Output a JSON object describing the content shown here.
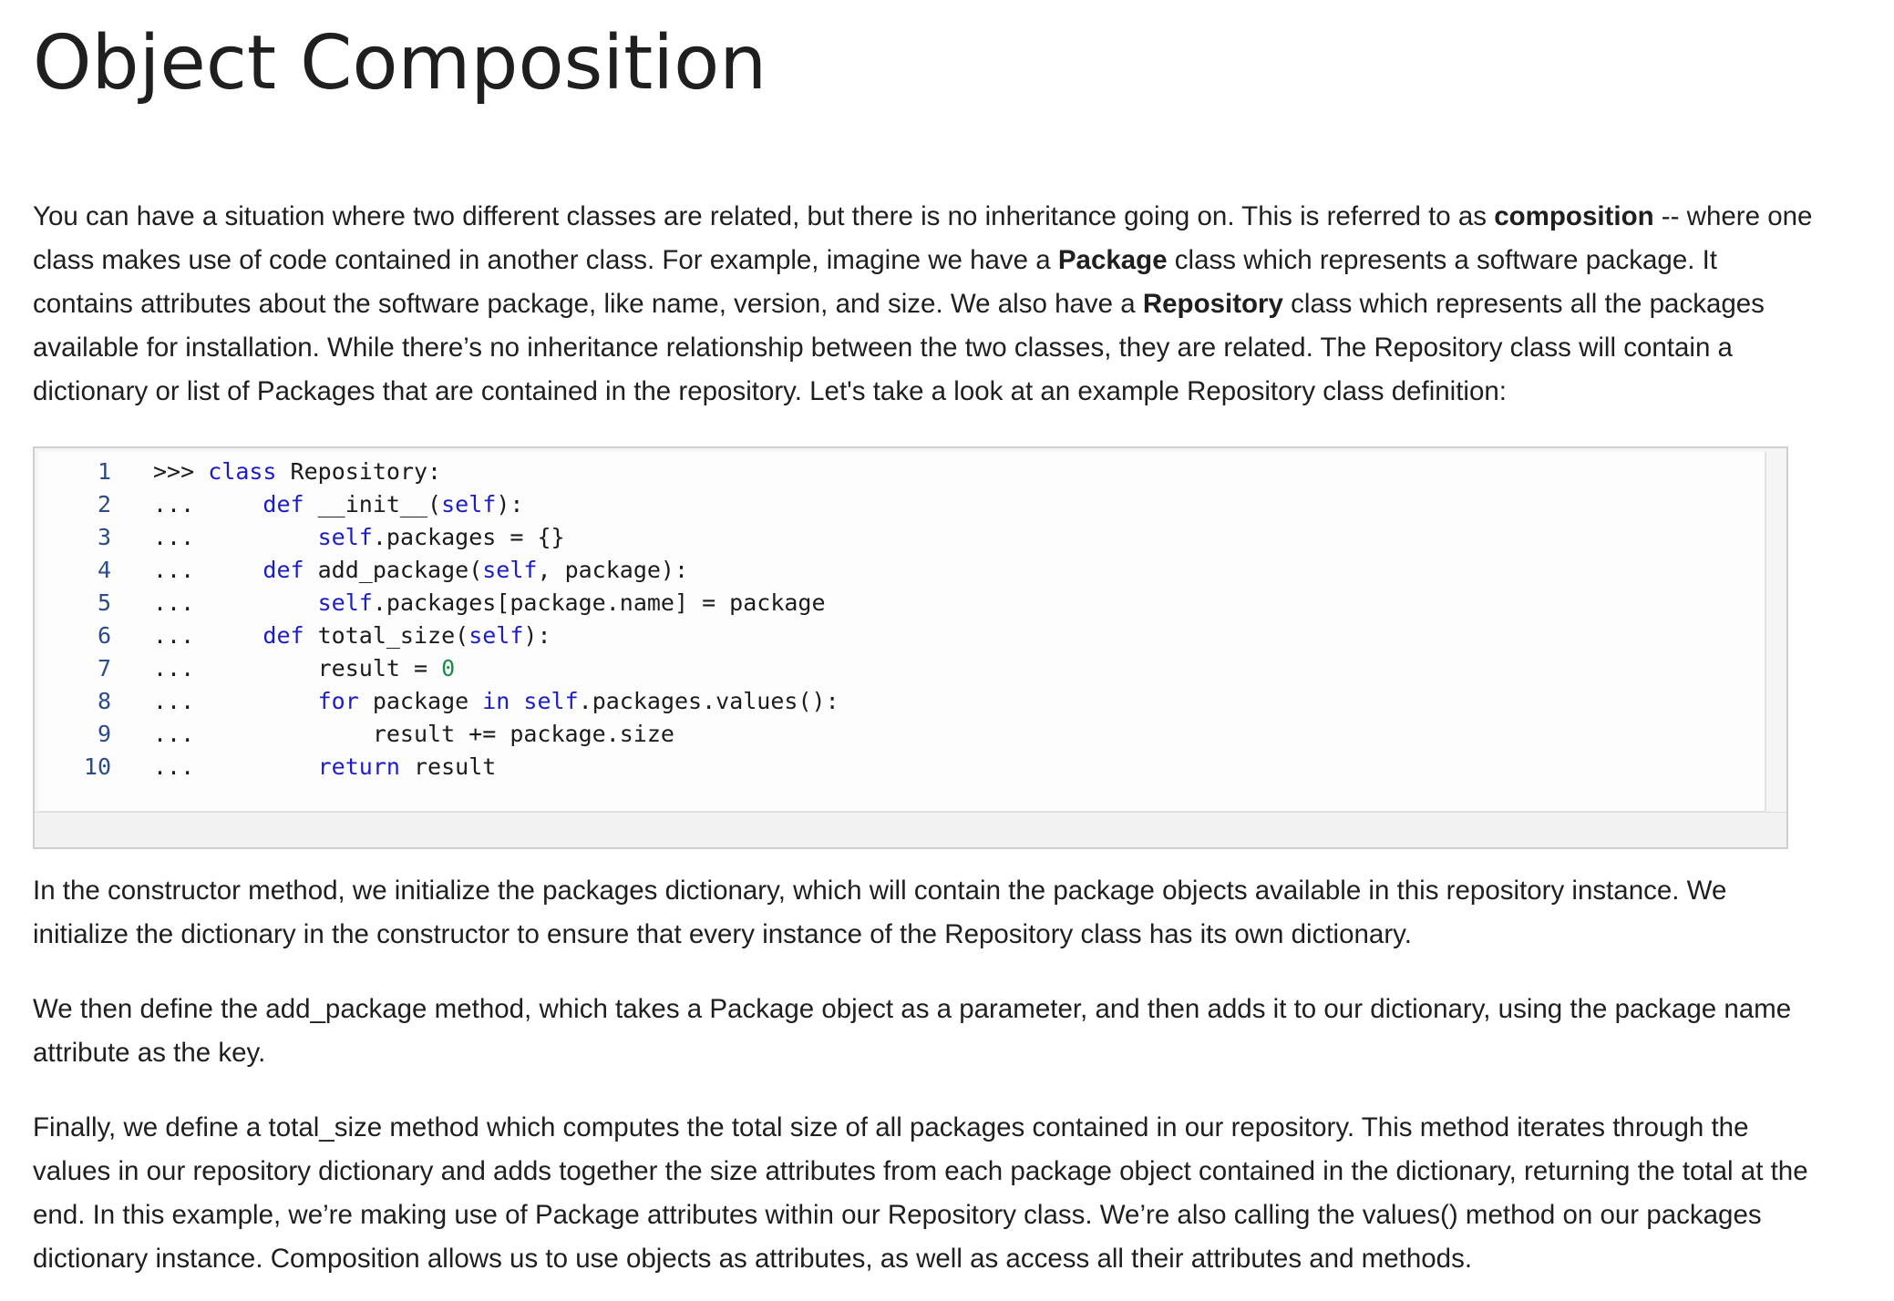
{
  "page": {
    "title": "Object Composition"
  },
  "intro": {
    "t1": "You can have a situation where two different classes are related, but there is no inheritance going on. This is referred to as ",
    "b1": "composition",
    "t2": " -- where one class makes use of code contained in another class. For example, imagine we have a ",
    "b2": "Package",
    "t3": " class which represents a software package. It contains attributes about the software package, like name, version, and size. We also have a ",
    "b3": "Repository",
    "t4": " class which represents all the packages available for installation. While there’s no inheritance relationship between the two classes, they are related. The Repository class will contain a dictionary or list of Packages that are contained in the repository. Let's take a look at an example Repository class definition:"
  },
  "code": {
    "lines": [
      {
        "num": "1",
        "segments": [
          {
            "t": ">>> ",
            "c": ""
          },
          {
            "t": "class",
            "c": "kw"
          },
          {
            "t": " Repository:",
            "c": ""
          }
        ]
      },
      {
        "num": "2",
        "segments": [
          {
            "t": "...     ",
            "c": ""
          },
          {
            "t": "def",
            "c": "kw"
          },
          {
            "t": " __init__(",
            "c": ""
          },
          {
            "t": "self",
            "c": "kw"
          },
          {
            "t": "):",
            "c": ""
          }
        ]
      },
      {
        "num": "3",
        "segments": [
          {
            "t": "...         ",
            "c": ""
          },
          {
            "t": "self",
            "c": "kw"
          },
          {
            "t": ".packages = {}",
            "c": ""
          }
        ]
      },
      {
        "num": "4",
        "segments": [
          {
            "t": "...     ",
            "c": ""
          },
          {
            "t": "def",
            "c": "kw"
          },
          {
            "t": " add_package(",
            "c": ""
          },
          {
            "t": "self",
            "c": "kw"
          },
          {
            "t": ", package):",
            "c": ""
          }
        ]
      },
      {
        "num": "5",
        "segments": [
          {
            "t": "...         ",
            "c": ""
          },
          {
            "t": "self",
            "c": "kw"
          },
          {
            "t": ".packages[package.name] = package",
            "c": ""
          }
        ]
      },
      {
        "num": "6",
        "segments": [
          {
            "t": "...     ",
            "c": ""
          },
          {
            "t": "def",
            "c": "kw"
          },
          {
            "t": " total_size(",
            "c": ""
          },
          {
            "t": "self",
            "c": "kw"
          },
          {
            "t": "):",
            "c": ""
          }
        ]
      },
      {
        "num": "7",
        "segments": [
          {
            "t": "...         result = ",
            "c": ""
          },
          {
            "t": "0",
            "c": "num"
          }
        ]
      },
      {
        "num": "8",
        "segments": [
          {
            "t": "...         ",
            "c": ""
          },
          {
            "t": "for",
            "c": "kw"
          },
          {
            "t": " package ",
            "c": ""
          },
          {
            "t": "in",
            "c": "kw"
          },
          {
            "t": " ",
            "c": ""
          },
          {
            "t": "self",
            "c": "kw"
          },
          {
            "t": ".packages.values():",
            "c": ""
          }
        ]
      },
      {
        "num": "9",
        "segments": [
          {
            "t": "...             result += package.size",
            "c": ""
          }
        ]
      },
      {
        "num": "10",
        "segments": [
          {
            "t": "...         ",
            "c": ""
          },
          {
            "t": "return",
            "c": "kw"
          },
          {
            "t": " result",
            "c": ""
          }
        ]
      }
    ]
  },
  "paragraphs": {
    "p2": "In the constructor method, we initialize the packages dictionary, which will contain the package objects available in this repository instance. We initialize the dictionary in the constructor to ensure that every instance of the Repository class has its own dictionary.",
    "p3": "We then define the add_package method, which takes a Package object as a parameter, and then adds it to our dictionary, using the package name attribute as the key.",
    "p4": "Finally, we define a total_size method which computes the total size of all packages contained in our repository. This method iterates through the values in our repository dictionary and adds together the size attributes from each package object contained in the dictionary, returning the total at the end. In this example, we’re making use of Package attributes within our Repository class. We’re also calling the values() method on our packages dictionary instance. Composition allows us to use objects as attributes, as well as access all their attributes and methods."
  }
}
